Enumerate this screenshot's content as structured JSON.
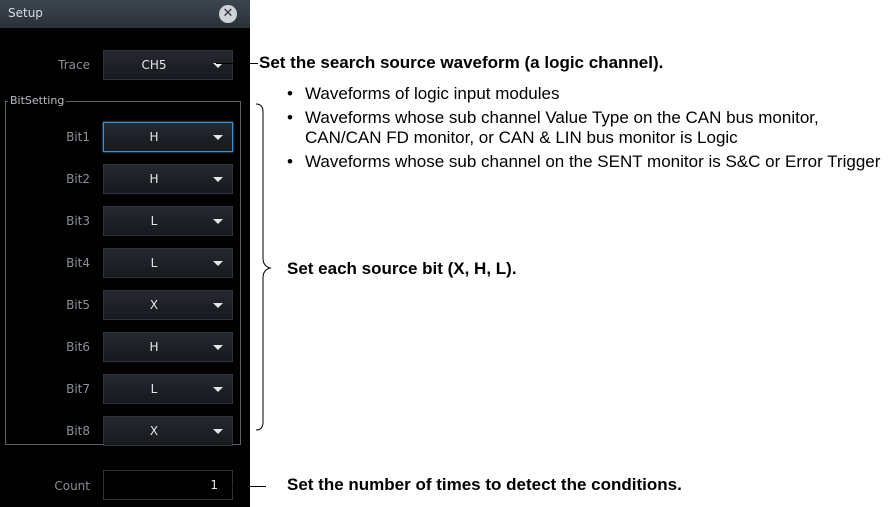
{
  "dialog": {
    "title": "Setup",
    "close_icon": "close-icon",
    "trace": {
      "label": "Trace",
      "value": "CH5"
    },
    "bit_group_label": "BitSetting",
    "bits": [
      {
        "label": "Bit1",
        "value": "H"
      },
      {
        "label": "Bit2",
        "value": "H"
      },
      {
        "label": "Bit3",
        "value": "L"
      },
      {
        "label": "Bit4",
        "value": "L"
      },
      {
        "label": "Bit5",
        "value": "X"
      },
      {
        "label": "Bit6",
        "value": "H"
      },
      {
        "label": "Bit7",
        "value": "L"
      },
      {
        "label": "Bit8",
        "value": "X"
      }
    ],
    "count": {
      "label": "Count",
      "value": "1"
    }
  },
  "annotations": {
    "trace_note": "Set the search source waveform (a logic channel).",
    "trace_bullets": [
      "Waveforms of logic input modules",
      "Waveforms whose sub channel Value Type on the CAN bus monitor, CAN/CAN FD monitor, or CAN & LIN bus monitor is Logic",
      "Waveforms whose sub channel on the SENT monitor is S&C or Error Trigger"
    ],
    "bits_note": "Set each source bit (X, H, L).",
    "count_note": "Set the number of times to detect the conditions.",
    "bullet_glyph": "•"
  },
  "colors": {
    "panel_bg": "#000000",
    "selected_border": "#3f8fd0",
    "text_dim": "#8a9097",
    "text_value": "#e4e7ea"
  }
}
